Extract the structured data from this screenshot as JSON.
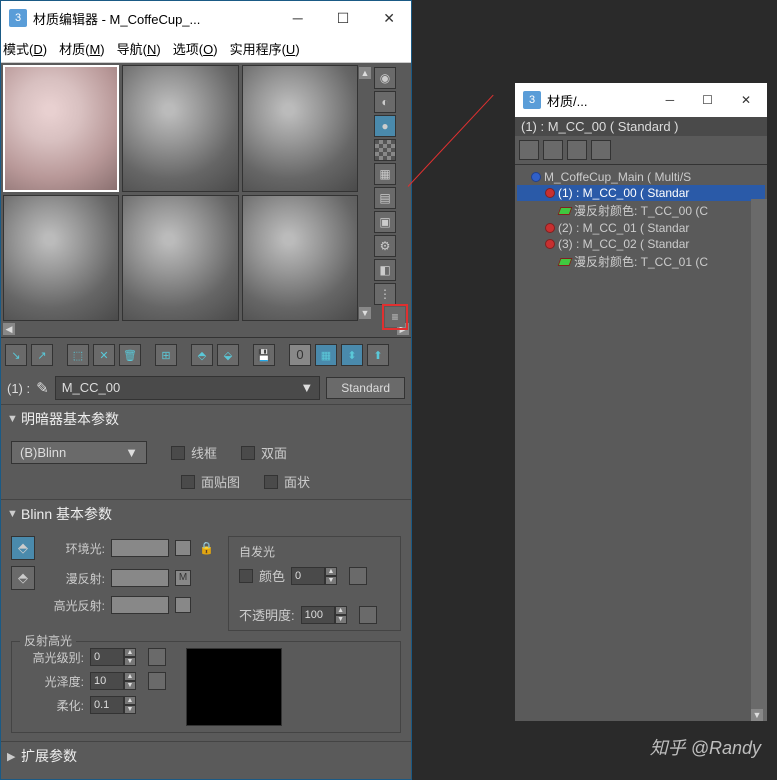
{
  "main_window": {
    "title": "材质编辑器 - M_CoffeCup_...",
    "menus": {
      "mode": "模式",
      "mode_u": "D",
      "material": "材质",
      "material_u": "M",
      "nav": "导航",
      "nav_u": "N",
      "options": "选项",
      "options_u": "O",
      "utilities": "实用程序",
      "utilities_u": "U"
    },
    "slot_num": "0",
    "name_label": "(1) :",
    "name_value": "M_CC_00",
    "type_button": "Standard",
    "rollouts": {
      "shader_basic": "明暗器基本参数",
      "shader_type": "(B)Blinn",
      "wire": "线框",
      "two_sided": "双面",
      "face_map": "面贴图",
      "faceted": "面状",
      "blinn_basic": "Blinn 基本参数",
      "ambient": "环境光:",
      "diffuse": "漫反射:",
      "specular": "高光反射:",
      "self_illum": "自发光",
      "color_lbl": "颜色",
      "color_val": "0",
      "opacity_lbl": "不透明度:",
      "opacity_val": "100",
      "m_label": "M",
      "spec_hl": "反射高光",
      "spec_level": "高光级别:",
      "spec_level_v": "0",
      "gloss": "光泽度:",
      "gloss_v": "10",
      "soften": "柔化:",
      "soften_v": "0.1",
      "extended": "扩展参数"
    }
  },
  "tree_window": {
    "title": "材质/...",
    "header": "(1) : M_CC_00  ( Standard )",
    "items": [
      {
        "indent": 1,
        "sel": false,
        "icon": "blue",
        "text": "M_CoffeCup_Main   ( Multi/S"
      },
      {
        "indent": 2,
        "sel": true,
        "icon": "red",
        "text": "(1) : M_CC_00  ( Standar"
      },
      {
        "indent": 3,
        "sel": false,
        "icon": "green",
        "text": "漫反射颜色: T_CC_00 (C"
      },
      {
        "indent": 2,
        "sel": false,
        "icon": "red",
        "text": "(2) : M_CC_01   ( Standar"
      },
      {
        "indent": 2,
        "sel": false,
        "icon": "red",
        "text": "(3) : M_CC_02   ( Standar"
      },
      {
        "indent": 3,
        "sel": false,
        "icon": "green",
        "text": "漫反射颜色: T_CC_01 (C"
      }
    ]
  },
  "watermark": "知乎 @Randy"
}
